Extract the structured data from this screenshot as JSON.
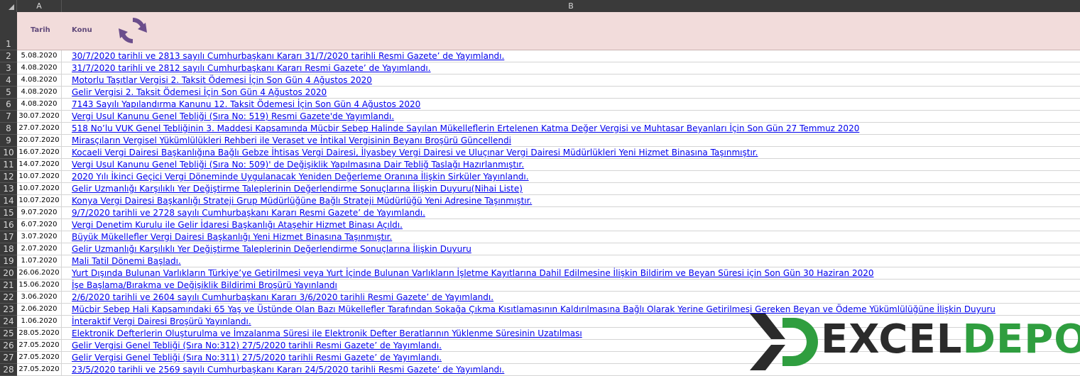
{
  "columns": {
    "a": "A",
    "b": "B"
  },
  "header": {
    "tarih": "Tarih",
    "konu": "Konu",
    "refresh_icon": "refresh-icon"
  },
  "logo": {
    "part1": "EXCEL",
    "part2": "DEPO",
    "accent": "#2f9e3f",
    "dark": "#2b2b2b"
  },
  "colors": {
    "link": "#0000ee",
    "header_bg": "#f2dcdb",
    "header_text": "#60497a",
    "refresh": "#6b4e8c"
  },
  "rows": [
    {
      "num": "1"
    },
    {
      "num": "2",
      "date": "5.08.2020",
      "title": "30/7/2020 tarihli ve 2813 sayılı Cumhurbaşkanı Kararı 31/7/2020 tarihli Resmi Gazete’ de Yayımlandı."
    },
    {
      "num": "3",
      "date": "4.08.2020",
      "title": "31/7/2020 tarihli ve 2812 sayılı Cumhurbaşkanı Kararı Resmi Gazete’ de Yayımlandı."
    },
    {
      "num": "4",
      "date": "4.08.2020",
      "title": "Motorlu Taşıtlar Vergisi 2. Taksit Ödemesi İçin Son Gün 4 Ağustos 2020"
    },
    {
      "num": "5",
      "date": "4.08.2020",
      "title": "Gelir Vergisi 2. Taksit Ödemesi İçin Son Gün 4 Ağustos 2020"
    },
    {
      "num": "6",
      "date": "4.08.2020",
      "title": "7143 Sayılı Yapılandırma Kanunu 12. Taksit Ödemesi İçin Son Gün 4 Ağustos 2020"
    },
    {
      "num": "7",
      "date": "30.07.2020",
      "title": "Vergi Usul Kanunu Genel Tebliği (Sıra No: 519) Resmi Gazete'de Yayımlandı."
    },
    {
      "num": "8",
      "date": "27.07.2020",
      "title": "518 No’lu VUK Genel Tebliğinin 3. Maddesi Kapsamında Mücbir Sebep Halinde Sayılan Mükelleflerin Ertelenen Katma Değer Vergisi ve Muhtasar Beyanları İçin Son Gün 27 Temmuz 2020"
    },
    {
      "num": "9",
      "date": "20.07.2020",
      "title": "Mirasçıların Vergisel Yükümlülükleri Rehberi ile Veraset ve İntikal Vergisinin Beyanı Broşürü Güncellendi"
    },
    {
      "num": "10",
      "date": "16.07.2020",
      "title": "Kocaeli Vergi Dairesi Başkanlığına Bağlı Gebze İhtisas Vergi Dairesi, İlyasbey Vergi Dairesi ve Uluçınar Vergi Dairesi Müdürlükleri Yeni Hizmet Binasına Taşınmıştır. "
    },
    {
      "num": "11",
      "date": "14.07.2020",
      "title": "Vergi Usul Kanunu Genel Tebliği (Sıra No: 509)' de Değişiklik Yapılmasına Dair Tebliğ Taslağı Hazırlanmıştır."
    },
    {
      "num": "12",
      "date": "10.07.2020",
      "title": "2020 Yılı İkinci Geçici Vergi Döneminde Uygulanacak Yeniden Değerleme Oranına İlişkin Sirküler Yayınlandı."
    },
    {
      "num": "13",
      "date": "10.07.2020",
      "title": "Gelir Uzmanlığı Karşılıklı Yer Değiştirme Taleplerinin Değerlendirme Sonuçlarına İlişkin Duyuru(Nihai Liste)"
    },
    {
      "num": "14",
      "date": "10.07.2020",
      "title": "Konya Vergi Dairesi Başkanlığı Strateji Grup Müdürlüğüne Bağlı Strateji Müdürlüğü Yeni Adresine Taşınmıştır."
    },
    {
      "num": "15",
      "date": "9.07.2020",
      "title": "9/7/2020 tarihli ve 2728 sayılı Cumhurbaşkanı Kararı Resmi Gazete’ de Yayımlandı."
    },
    {
      "num": "16",
      "date": "6.07.2020",
      "title": "Vergi Denetim Kurulu ile Gelir İdaresi Başkanlığı Ataşehir Hizmet Binası Açıldı."
    },
    {
      "num": "17",
      "date": "3.07.2020",
      "title": "Büyük Mükellefler Vergi Dairesi Başkanlığı Yeni Hizmet Binasına Taşınmıştır. "
    },
    {
      "num": "18",
      "date": "2.07.2020",
      "title": "Gelir Uzmanlığı Karşılıklı Yer Değiştirme Taleplerinin Değerlendirme Sonuçlarına İlişkin Duyuru"
    },
    {
      "num": "19",
      "date": "1.07.2020",
      "title": "Mali Tatil Dönemi Başladı."
    },
    {
      "num": "20",
      "date": "26.06.2020",
      "title": "Yurt Dışında Bulunan Varlıkların Türkiye’ye Getirilmesi veya Yurt İçinde Bulunan Varlıkların İşletme Kayıtlarına Dahil Edilmesine İlişkin Bildirim ve Beyan Süresi için Son Gün 30 Haziran 2020"
    },
    {
      "num": "21",
      "date": "15.06.2020",
      "title": "İşe Başlama/Bırakma ve Değişiklik Bildirimi Broşürü Yayınlandı"
    },
    {
      "num": "22",
      "date": "3.06.2020",
      "title": "2/6/2020 tarihli ve 2604 sayılı Cumhurbaşkanı Kararı 3/6/2020 tarihli Resmi Gazete’ de Yayımlandı."
    },
    {
      "num": "23",
      "date": "2.06.2020",
      "title": "Mücbir Sebep Hali Kapsamındaki 65 Yaş ve Üstünde Olan Bazı Mükellefler Tarafından Sokağa Çıkma Kısıtlamasının Kaldırılmasına Bağlı Olarak Yerine Getirilmesi Gereken Beyan ve Ödeme Yükümlülüğüne İlişkin Duyuru"
    },
    {
      "num": "24",
      "date": "1.06.2020",
      "title": "İnteraktif Vergi Dairesi Broşürü Yayınlandı."
    },
    {
      "num": "25",
      "date": "28.05.2020",
      "title": "Elektronik Defterlerin Oluşturulma ve İmzalanma Süresi ile Elektronik Defter Beratlarının Yüklenme Süresinin Uzatılması"
    },
    {
      "num": "26",
      "date": "27.05.2020",
      "title": "Gelir Vergisi Genel Tebliği (Sıra No:312) 27/5/2020 tarihli Resmi Gazete’ de Yayımlandı."
    },
    {
      "num": "27",
      "date": "27.05.2020",
      "title": "Gelir Vergisi Genel Tebliği (Sıra No:311) 27/5/2020 tarihli Resmi Gazete’ de Yayımlandı."
    },
    {
      "num": "28",
      "date": "27.05.2020",
      "title": "23/5/2020 tarihli ve 2569 sayılı Cumhurbaşkanı Kararı 24/5/2020 tarihli Resmi Gazete’ de Yayımlandı."
    }
  ]
}
